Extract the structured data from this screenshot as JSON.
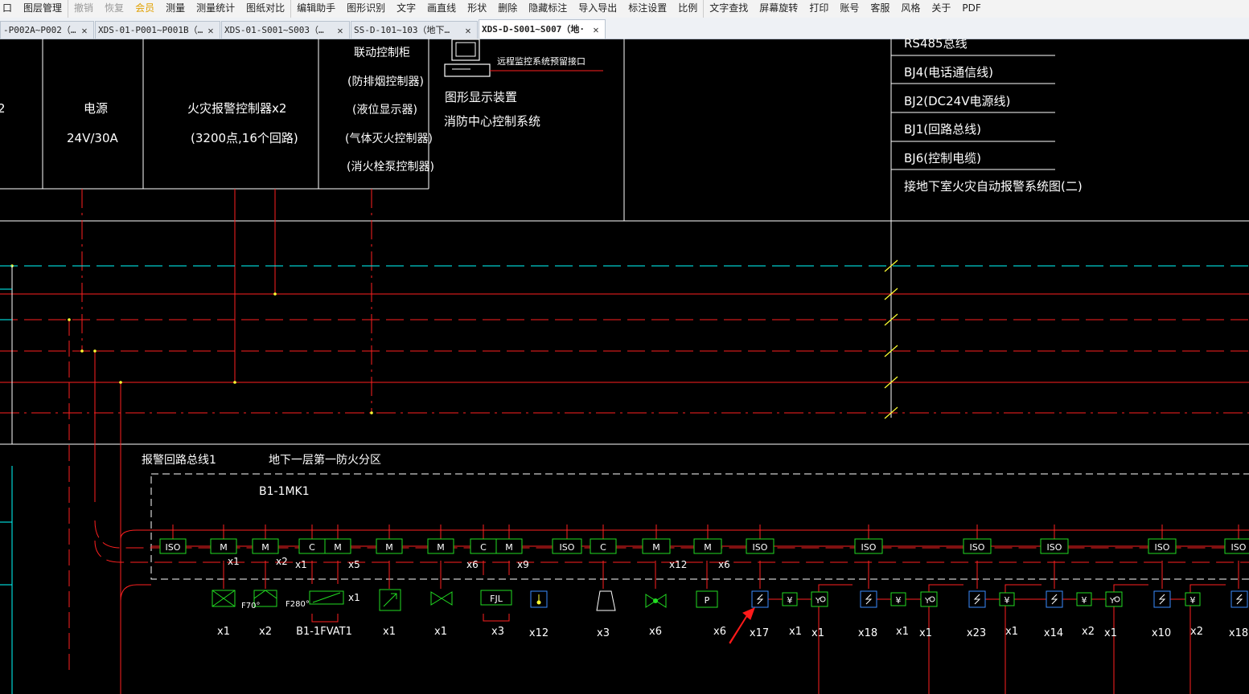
{
  "menu": [
    "口",
    "图层管理",
    "撤销",
    "恢复",
    "会员",
    "测量",
    "测量统计",
    "图纸对比",
    "编辑助手",
    "图形识别",
    "文字",
    "画直线",
    "形状",
    "删除",
    "隐藏标注",
    "导入导出",
    "标注设置",
    "比例",
    "文字查找",
    "屏幕旋转",
    "打印",
    "账号",
    "客服",
    "风格",
    "关于",
    "PDF"
  ],
  "tabs": [
    {
      "label": "-P002A~P002（…",
      "active": false
    },
    {
      "label": "XDS-01-P001~P001B（…",
      "active": false
    },
    {
      "label": "XDS-01-S001~S003（…",
      "active": false
    },
    {
      "label": "SS-D-101~103（地下…",
      "active": false
    },
    {
      "label": "XDS-D-S001~S007（地·",
      "active": true
    }
  ],
  "cad": {
    "equipment": {
      "left_cut": "2",
      "power_title": "电源",
      "power_spec": "24V/30A",
      "alarm_ctrl": "火灾报警控制器x2",
      "alarm_ctrl_spec": "(3200点,16个回路)",
      "linkage_title": "联动控制柜",
      "linkage_items": [
        "(防排烟控制器)",
        "(液位显示器)",
        "(气体灭火控制器)",
        "(消火栓泵控制器)"
      ],
      "remote_port": "远程监控系统预留接口",
      "display_unit": "图形显示装置",
      "control_system": "消防中心控制系统"
    },
    "legend": [
      "RS485总线",
      "BJ4(电话通信线)",
      "BJ2(DC24V电源线)",
      "BJ1(回路总线)",
      "BJ6(控制电缆)",
      "接地下室火灾自动报警系统图(二)"
    ],
    "bus_label": "报警回路总线1",
    "zone_label": "地下一层第一防火分区",
    "panel_label": "B1-1MK1",
    "modules": [
      "ISO",
      "M",
      "M",
      "C",
      "M",
      "M",
      "M",
      "C",
      "M",
      "ISO",
      "C",
      "M",
      "M",
      "ISO",
      "ISO",
      "ISO",
      "ISO",
      "ISO",
      "ISO"
    ],
    "module_counts": [
      "x1",
      "x2",
      "x1",
      "x5",
      "x6",
      "x9",
      "x12",
      "x6"
    ],
    "device_labels": [
      "F70°",
      "F280°",
      "FJL",
      "P"
    ],
    "device_counts": [
      "x1",
      "x2",
      "B1-1FVAT1",
      "x1",
      "x1",
      "x3",
      "x12",
      "x3",
      "x6",
      "x6",
      "x17",
      "x1",
      "x1",
      "x18",
      "x1",
      "x1",
      "x23",
      "x1",
      "x14",
      "x2",
      "x1",
      "x10",
      "x2",
      "x18"
    ]
  },
  "colors": {
    "canvas": "#000000",
    "red": "#ff2020",
    "white": "#ffffff",
    "cyan": "#00ffff",
    "yellow": "#ffff33",
    "green": "#22dd22",
    "blue": "#3a8cff",
    "accent": "#e0a000",
    "arrow": "#ff1a1a"
  }
}
